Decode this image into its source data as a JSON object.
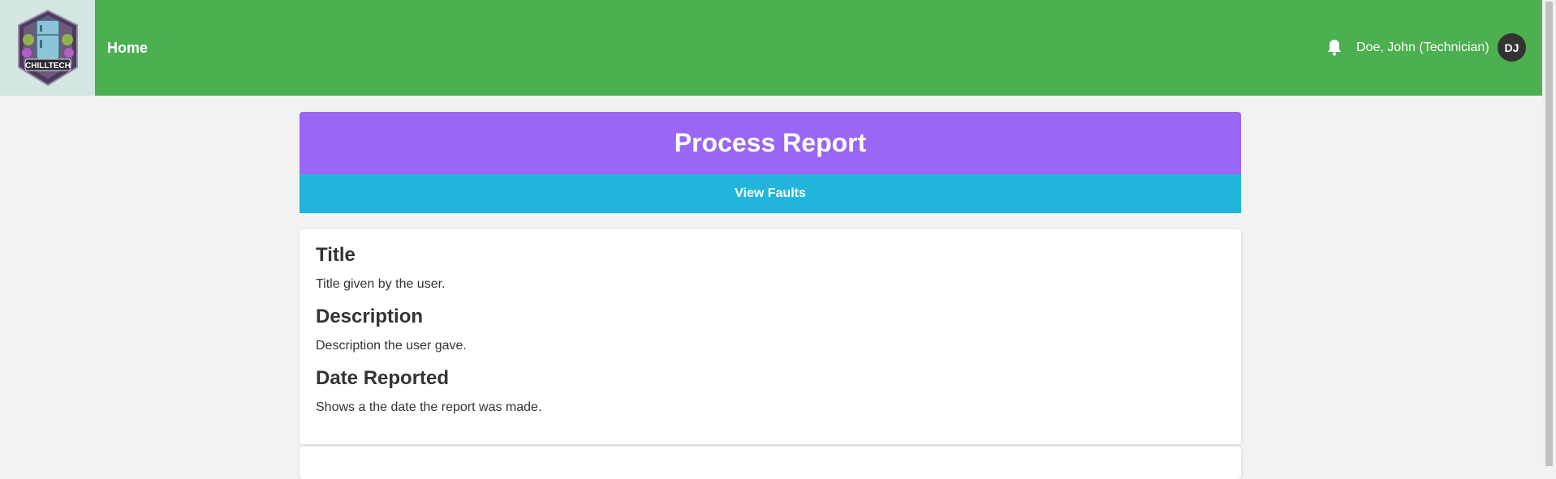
{
  "brand": {
    "logo_text": "CHILLTECH"
  },
  "nav": {
    "home_label": "Home"
  },
  "user": {
    "display_name": "Doe, John (Technician)",
    "initials": "DJ"
  },
  "report": {
    "header_title": "Process Report",
    "view_faults_label": "View Faults",
    "fields": [
      {
        "label": "Title",
        "value": "Title given by the user."
      },
      {
        "label": "Description",
        "value": "Description the user gave."
      },
      {
        "label": "Date Reported",
        "value": "Shows a the date the report was made."
      }
    ]
  },
  "colors": {
    "topbar": "#4caf50",
    "header": "#9966f5",
    "view_faults": "#22b5dc",
    "avatar": "#333333"
  },
  "icons": {
    "notifications": "bell-icon",
    "logo": "chilltech-logo"
  }
}
